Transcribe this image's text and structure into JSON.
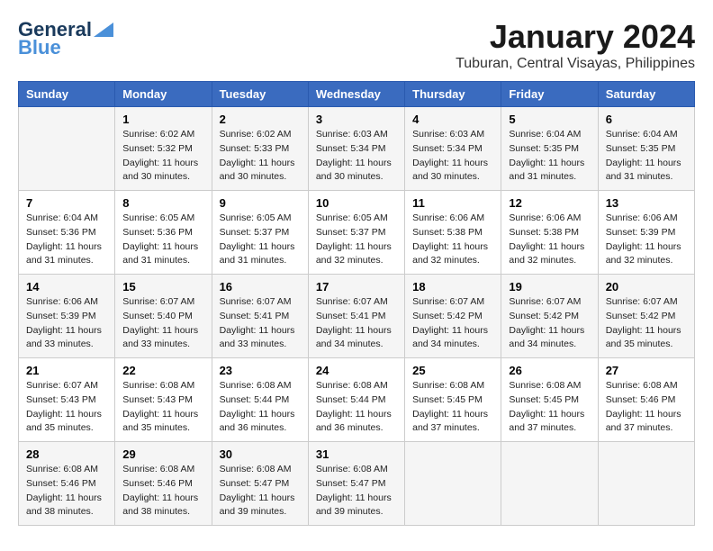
{
  "logo": {
    "general": "General",
    "blue": "Blue"
  },
  "title": "January 2024",
  "subtitle": "Tuburan, Central Visayas, Philippines",
  "days_header": [
    "Sunday",
    "Monday",
    "Tuesday",
    "Wednesday",
    "Thursday",
    "Friday",
    "Saturday"
  ],
  "weeks": [
    [
      {
        "day": "",
        "sunrise": "",
        "sunset": "",
        "daylight": ""
      },
      {
        "day": "1",
        "sunrise": "Sunrise: 6:02 AM",
        "sunset": "Sunset: 5:32 PM",
        "daylight": "Daylight: 11 hours and 30 minutes."
      },
      {
        "day": "2",
        "sunrise": "Sunrise: 6:02 AM",
        "sunset": "Sunset: 5:33 PM",
        "daylight": "Daylight: 11 hours and 30 minutes."
      },
      {
        "day": "3",
        "sunrise": "Sunrise: 6:03 AM",
        "sunset": "Sunset: 5:34 PM",
        "daylight": "Daylight: 11 hours and 30 minutes."
      },
      {
        "day": "4",
        "sunrise": "Sunrise: 6:03 AM",
        "sunset": "Sunset: 5:34 PM",
        "daylight": "Daylight: 11 hours and 30 minutes."
      },
      {
        "day": "5",
        "sunrise": "Sunrise: 6:04 AM",
        "sunset": "Sunset: 5:35 PM",
        "daylight": "Daylight: 11 hours and 31 minutes."
      },
      {
        "day": "6",
        "sunrise": "Sunrise: 6:04 AM",
        "sunset": "Sunset: 5:35 PM",
        "daylight": "Daylight: 11 hours and 31 minutes."
      }
    ],
    [
      {
        "day": "7",
        "sunrise": "Sunrise: 6:04 AM",
        "sunset": "Sunset: 5:36 PM",
        "daylight": "Daylight: 11 hours and 31 minutes."
      },
      {
        "day": "8",
        "sunrise": "Sunrise: 6:05 AM",
        "sunset": "Sunset: 5:36 PM",
        "daylight": "Daylight: 11 hours and 31 minutes."
      },
      {
        "day": "9",
        "sunrise": "Sunrise: 6:05 AM",
        "sunset": "Sunset: 5:37 PM",
        "daylight": "Daylight: 11 hours and 31 minutes."
      },
      {
        "day": "10",
        "sunrise": "Sunrise: 6:05 AM",
        "sunset": "Sunset: 5:37 PM",
        "daylight": "Daylight: 11 hours and 32 minutes."
      },
      {
        "day": "11",
        "sunrise": "Sunrise: 6:06 AM",
        "sunset": "Sunset: 5:38 PM",
        "daylight": "Daylight: 11 hours and 32 minutes."
      },
      {
        "day": "12",
        "sunrise": "Sunrise: 6:06 AM",
        "sunset": "Sunset: 5:38 PM",
        "daylight": "Daylight: 11 hours and 32 minutes."
      },
      {
        "day": "13",
        "sunrise": "Sunrise: 6:06 AM",
        "sunset": "Sunset: 5:39 PM",
        "daylight": "Daylight: 11 hours and 32 minutes."
      }
    ],
    [
      {
        "day": "14",
        "sunrise": "Sunrise: 6:06 AM",
        "sunset": "Sunset: 5:39 PM",
        "daylight": "Daylight: 11 hours and 33 minutes."
      },
      {
        "day": "15",
        "sunrise": "Sunrise: 6:07 AM",
        "sunset": "Sunset: 5:40 PM",
        "daylight": "Daylight: 11 hours and 33 minutes."
      },
      {
        "day": "16",
        "sunrise": "Sunrise: 6:07 AM",
        "sunset": "Sunset: 5:41 PM",
        "daylight": "Daylight: 11 hours and 33 minutes."
      },
      {
        "day": "17",
        "sunrise": "Sunrise: 6:07 AM",
        "sunset": "Sunset: 5:41 PM",
        "daylight": "Daylight: 11 hours and 34 minutes."
      },
      {
        "day": "18",
        "sunrise": "Sunrise: 6:07 AM",
        "sunset": "Sunset: 5:42 PM",
        "daylight": "Daylight: 11 hours and 34 minutes."
      },
      {
        "day": "19",
        "sunrise": "Sunrise: 6:07 AM",
        "sunset": "Sunset: 5:42 PM",
        "daylight": "Daylight: 11 hours and 34 minutes."
      },
      {
        "day": "20",
        "sunrise": "Sunrise: 6:07 AM",
        "sunset": "Sunset: 5:42 PM",
        "daylight": "Daylight: 11 hours and 35 minutes."
      }
    ],
    [
      {
        "day": "21",
        "sunrise": "Sunrise: 6:07 AM",
        "sunset": "Sunset: 5:43 PM",
        "daylight": "Daylight: 11 hours and 35 minutes."
      },
      {
        "day": "22",
        "sunrise": "Sunrise: 6:08 AM",
        "sunset": "Sunset: 5:43 PM",
        "daylight": "Daylight: 11 hours and 35 minutes."
      },
      {
        "day": "23",
        "sunrise": "Sunrise: 6:08 AM",
        "sunset": "Sunset: 5:44 PM",
        "daylight": "Daylight: 11 hours and 36 minutes."
      },
      {
        "day": "24",
        "sunrise": "Sunrise: 6:08 AM",
        "sunset": "Sunset: 5:44 PM",
        "daylight": "Daylight: 11 hours and 36 minutes."
      },
      {
        "day": "25",
        "sunrise": "Sunrise: 6:08 AM",
        "sunset": "Sunset: 5:45 PM",
        "daylight": "Daylight: 11 hours and 37 minutes."
      },
      {
        "day": "26",
        "sunrise": "Sunrise: 6:08 AM",
        "sunset": "Sunset: 5:45 PM",
        "daylight": "Daylight: 11 hours and 37 minutes."
      },
      {
        "day": "27",
        "sunrise": "Sunrise: 6:08 AM",
        "sunset": "Sunset: 5:46 PM",
        "daylight": "Daylight: 11 hours and 37 minutes."
      }
    ],
    [
      {
        "day": "28",
        "sunrise": "Sunrise: 6:08 AM",
        "sunset": "Sunset: 5:46 PM",
        "daylight": "Daylight: 11 hours and 38 minutes."
      },
      {
        "day": "29",
        "sunrise": "Sunrise: 6:08 AM",
        "sunset": "Sunset: 5:46 PM",
        "daylight": "Daylight: 11 hours and 38 minutes."
      },
      {
        "day": "30",
        "sunrise": "Sunrise: 6:08 AM",
        "sunset": "Sunset: 5:47 PM",
        "daylight": "Daylight: 11 hours and 39 minutes."
      },
      {
        "day": "31",
        "sunrise": "Sunrise: 6:08 AM",
        "sunset": "Sunset: 5:47 PM",
        "daylight": "Daylight: 11 hours and 39 minutes."
      },
      {
        "day": "",
        "sunrise": "",
        "sunset": "",
        "daylight": ""
      },
      {
        "day": "",
        "sunrise": "",
        "sunset": "",
        "daylight": ""
      },
      {
        "day": "",
        "sunrise": "",
        "sunset": "",
        "daylight": ""
      }
    ]
  ]
}
